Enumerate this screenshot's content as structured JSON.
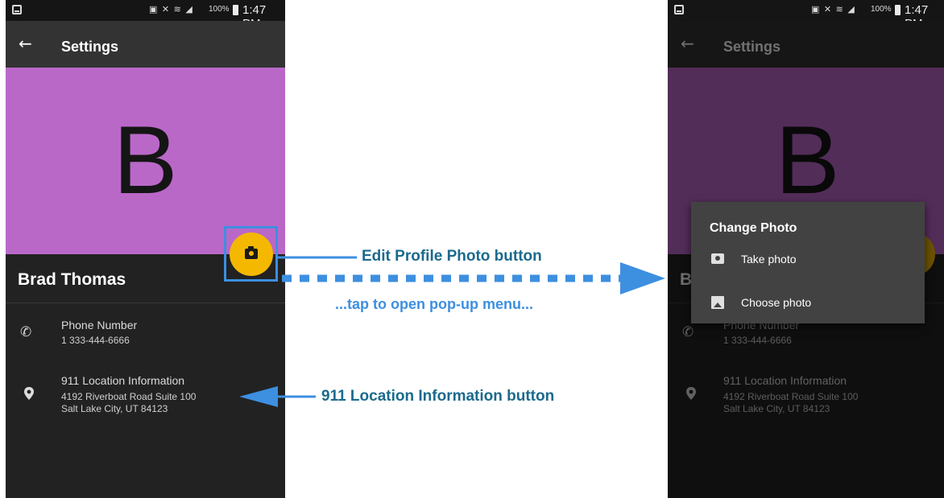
{
  "status_bar": {
    "battery": "100%",
    "time": "1:47 PM"
  },
  "app_bar": {
    "back_glyph": "←",
    "title": "Settings"
  },
  "profile": {
    "initial": "B",
    "name": "Brad Thomas",
    "hero_color": "#ba68c8",
    "fab_color": "#f5b800"
  },
  "rows": {
    "phone": {
      "title": "Phone Number",
      "value": "1 333-444-6666"
    },
    "location": {
      "title": "911 Location Information",
      "line1": "4192 Riverboat Road Suite 100",
      "line2": "Salt Lake City, UT 84123"
    }
  },
  "popup": {
    "title": "Change Photo",
    "items": [
      {
        "label": "Take photo",
        "icon": "camera-icon"
      },
      {
        "label": "Choose photo",
        "icon": "image-icon"
      }
    ]
  },
  "callouts": {
    "edit": "Edit Profile Photo button",
    "tap": "...tap to open pop-up menu...",
    "location": "911 Location Information button",
    "color": "#1b6a8c",
    "arrow_color": "#3d8fe0"
  }
}
